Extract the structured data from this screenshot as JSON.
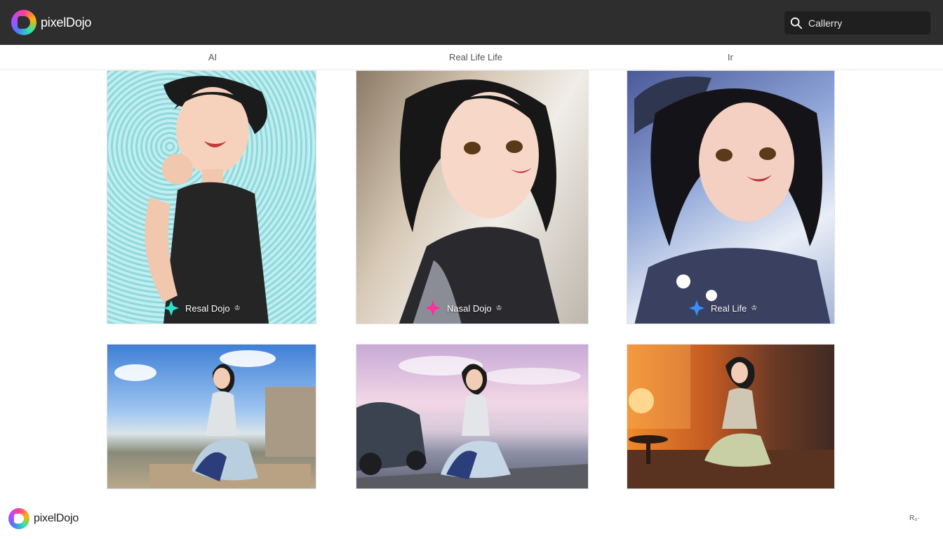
{
  "header": {
    "brand": "pixelDojo",
    "logo_icon": "pixeldojo-logo-icon",
    "search": {
      "icon": "search-icon",
      "placeholder": "Callerry"
    }
  },
  "tabs": [
    {
      "label": "AI"
    },
    {
      "label": "Real Life Life"
    },
    {
      "label": "Ir"
    }
  ],
  "gallery": {
    "cards": [
      {
        "badge": {
          "label": "Resal Dojo",
          "star_color": "#2fe0d0"
        }
      },
      {
        "badge": {
          "label": "Nasal Dojo",
          "star_color": "#ff2fa0"
        }
      },
      {
        "badge": {
          "label": "Real Life",
          "star_color": "#3a8dff"
        }
      },
      {
        "badge": null
      },
      {
        "badge": null
      },
      {
        "badge": null
      }
    ]
  },
  "footer": {
    "brand": "pixelDojo",
    "right_text": "R₀·"
  },
  "colors": {
    "topbar": "#2e2e2e",
    "search_bg": "#1f1f1f"
  }
}
